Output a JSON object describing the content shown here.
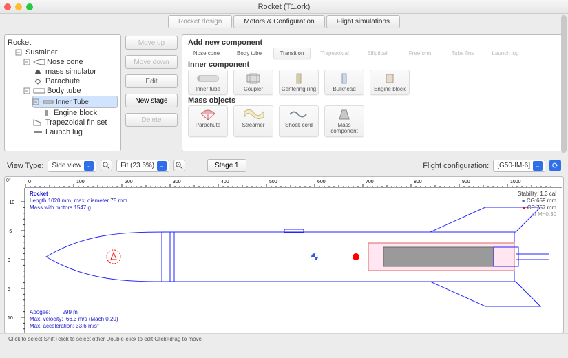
{
  "window": {
    "title": "Rocket (T1.ork)"
  },
  "tabs": [
    {
      "label": "Rocket design",
      "active": true
    },
    {
      "label": "Motors & Configuration",
      "active": false
    },
    {
      "label": "Flight simulations",
      "active": false
    }
  ],
  "tree": {
    "root": "Rocket",
    "stage": "Sustainer",
    "items": [
      {
        "label": "Nose cone",
        "children": [
          "mass simulator",
          "Parachute"
        ]
      },
      {
        "label": "Body tube",
        "children": [
          "Inner Tube",
          "Trapezoidal fin set",
          "Launch lug"
        ],
        "inner_child": "Engine block",
        "selected_child": "Inner Tube"
      }
    ]
  },
  "tree_buttons": {
    "move_up": "Move up",
    "move_down": "Move down",
    "edit": "Edit",
    "new_stage": "New stage",
    "delete": "Delete"
  },
  "palette": {
    "heading_add": "Add new component",
    "top_row": [
      "Nose cone",
      "Body tube",
      "Transition",
      "Trapezoidal",
      "Elliptical",
      "Freeform",
      "Tube fins",
      "Launch lug"
    ],
    "heading_inner": "Inner component",
    "inner_row": [
      "Inner tube",
      "Coupler",
      "Centering ring",
      "Bulkhead",
      "Engine block"
    ],
    "heading_mass": "Mass objects",
    "mass_row": [
      "Parachute",
      "Streamer",
      "Shock cord",
      "Mass component"
    ]
  },
  "viewbar": {
    "view_type_label": "View Type:",
    "view_type_value": "Side view",
    "zoom_value": "Fit (23.6%)",
    "stage_label": "Stage 1",
    "flight_config_label": "Flight configuration:",
    "flight_config_value": "[G50-IM-6]"
  },
  "design_info": {
    "name": "Rocket",
    "length_line": "Length 1020 mm, max. diameter 75 mm",
    "mass_line": "Mass with motors 1547 g"
  },
  "stability_info": {
    "stability_label": "Stability:",
    "stability_value": "1.3 cal",
    "cg_label": "CG:",
    "cg_value": "659 mm",
    "cp_label": "CP:",
    "cp_value": "757 mm",
    "version": "at M=0.30"
  },
  "flight_data": {
    "apogee_label": "Apogee:",
    "apogee_value": "299 m",
    "vel_label": "Max. velocity:",
    "vel_value": "66.3 m/s  (Mach 0.20)",
    "acc_label": "Max. acceleration:",
    "acc_value": "33.6 m/s²"
  },
  "ruler": {
    "x_ticks": [
      "0",
      "100",
      "200",
      "300",
      "400",
      "500",
      "600",
      "700",
      "800",
      "900",
      "1000"
    ],
    "y_label": "0°",
    "y_ticks": [
      "-10",
      "-5",
      "0",
      "5",
      "10"
    ]
  },
  "statusbar": "Click to select    Shift+click to select other    Double-click to edit    Click+drag to move",
  "colors": {
    "rocket_stroke": "#2323ff",
    "mass_sim": "#ff0000",
    "cg": "#2f5fd8",
    "cp": "#ff0000"
  },
  "chart_data": {
    "type": "diagram",
    "x_axis_mm": [
      0,
      1000
    ],
    "components": [
      {
        "name": "Nose cone",
        "x_start_mm": 0,
        "x_end_mm": 270,
        "diameter_mm": 75
      },
      {
        "name": "Body tube",
        "x_start_mm": 270,
        "x_end_mm": 940,
        "diameter_mm": 75
      },
      {
        "name": "Inner tube",
        "x_start_mm": 840,
        "x_end_mm": 940,
        "diameter_mm": 40
      },
      {
        "name": "Fins",
        "root_x_mm": [
          780,
          940
        ]
      },
      {
        "name": "Mass simulator",
        "x_mm": 165
      },
      {
        "name": "Launch lug",
        "x_mm": 510
      }
    ],
    "cg_mm": 659,
    "cp_mm": 757,
    "length_mm": 1020,
    "max_diameter_mm": 75,
    "mass_g": 1547
  }
}
